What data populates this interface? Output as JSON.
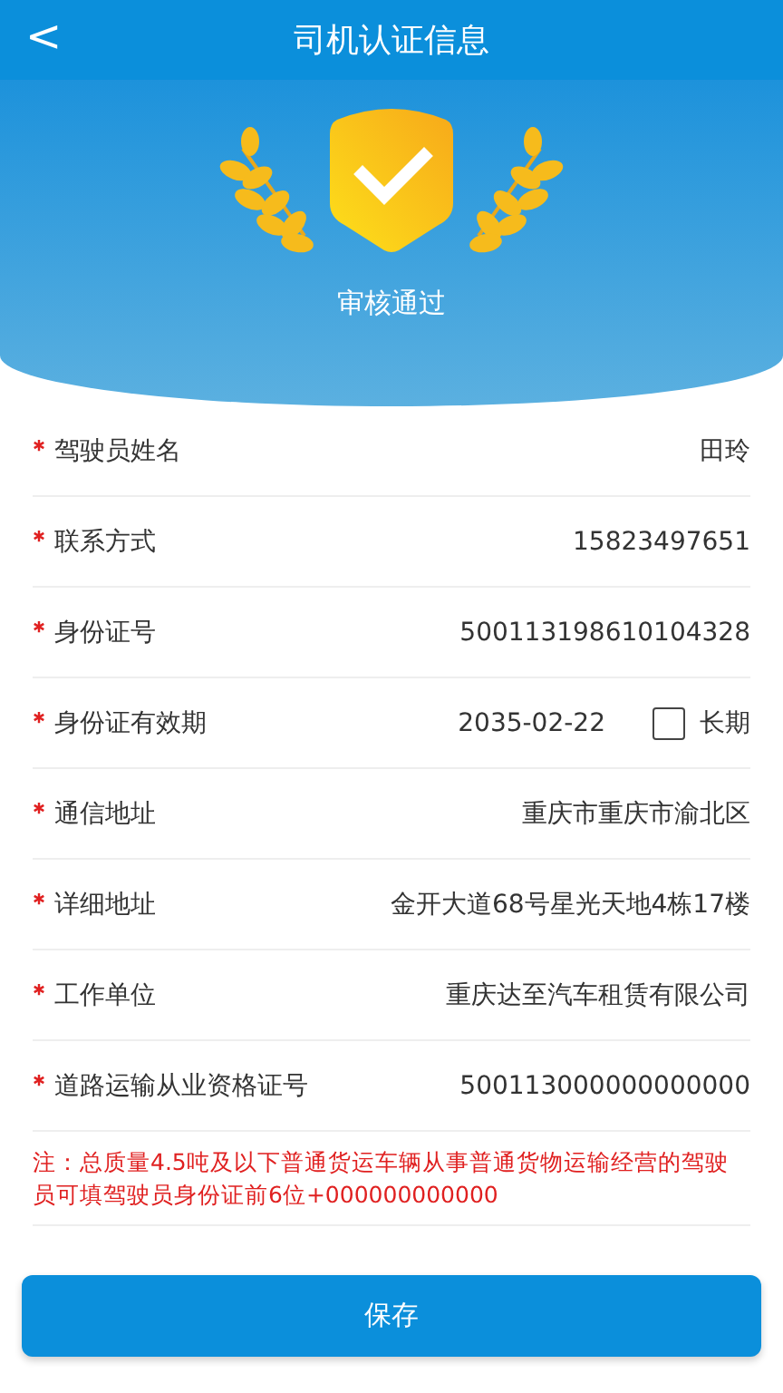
{
  "header": {
    "back_icon": "<",
    "title": "司机认证信息"
  },
  "banner": {
    "status": "审核通过"
  },
  "fields": [
    {
      "kind": "text",
      "required": true,
      "label": "驾驶员姓名",
      "value": "田玲"
    },
    {
      "kind": "text",
      "required": true,
      "label": "联系方式",
      "value": "15823497651"
    },
    {
      "kind": "text",
      "required": true,
      "label": "身份证号",
      "value": "500113198610104328"
    },
    {
      "kind": "date",
      "required": true,
      "label": "身份证有效期",
      "value": "2035-02-22",
      "option": {
        "label": "长期",
        "checked": false
      }
    },
    {
      "kind": "text",
      "required": true,
      "label": "通信地址",
      "value": "重庆市重庆市渝北区"
    },
    {
      "kind": "text",
      "required": true,
      "label": "详细地址",
      "value": "金开大道68号星光天地4栋17楼"
    },
    {
      "kind": "text",
      "required": true,
      "label": "工作单位",
      "value": "重庆达至汽车租赁有限公司"
    },
    {
      "kind": "text",
      "required": true,
      "label": "道路运输从业资格证号",
      "value": "500113000000000000"
    }
  ],
  "note": "注：总质量4.5吨及以下普通货运车辆从事普通货物运输经营的驾驶员可填驾驶员身份证前6位+000000000000",
  "save_button": "保存"
}
